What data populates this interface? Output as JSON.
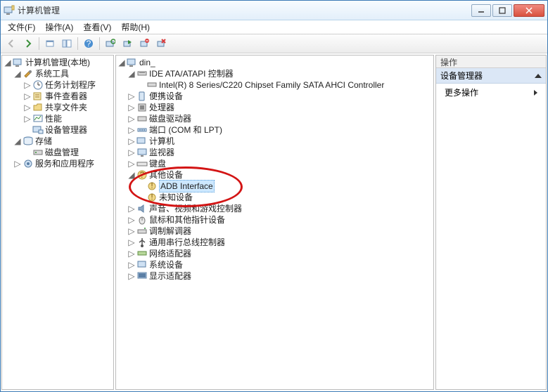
{
  "window": {
    "title": "计算机管理"
  },
  "menu": {
    "file": "文件(F)",
    "action": "操作(A)",
    "view": "查看(V)",
    "help": "帮助(H)"
  },
  "left_tree": {
    "root": "计算机管理(本地)",
    "system_tools": "系统工具",
    "task_scheduler": "任务计划程序",
    "event_viewer": "事件查看器",
    "shared_folders": "共享文件夹",
    "performance": "性能",
    "device_manager": "设备管理器",
    "storage": "存储",
    "disk_mgmt": "磁盘管理",
    "services": "服务和应用程序"
  },
  "center_tree": {
    "root": "din_",
    "ide": "IDE ATA/ATAPI 控制器",
    "ide_child": "Intel(R) 8 Series/C220 Chipset Family SATA AHCI Controller",
    "portable": "便携设备",
    "processors": "处理器",
    "disk_drives": "磁盘驱动器",
    "ports": "端口 (COM 和 LPT)",
    "computer": "计算机",
    "monitors": "监视器",
    "keyboards": "键盘",
    "other": "其他设备",
    "other_adb": "ADB Interface",
    "other_unknown": "未知设备",
    "sound": "声音、视频和游戏控制器",
    "mouse": "鼠标和其他指针设备",
    "modems": "调制解调器",
    "usb": "通用串行总线控制器",
    "network": "网络适配器",
    "system": "系统设备",
    "display": "显示适配器"
  },
  "actions": {
    "header": "操作",
    "category": "设备管理器",
    "more": "更多操作"
  }
}
